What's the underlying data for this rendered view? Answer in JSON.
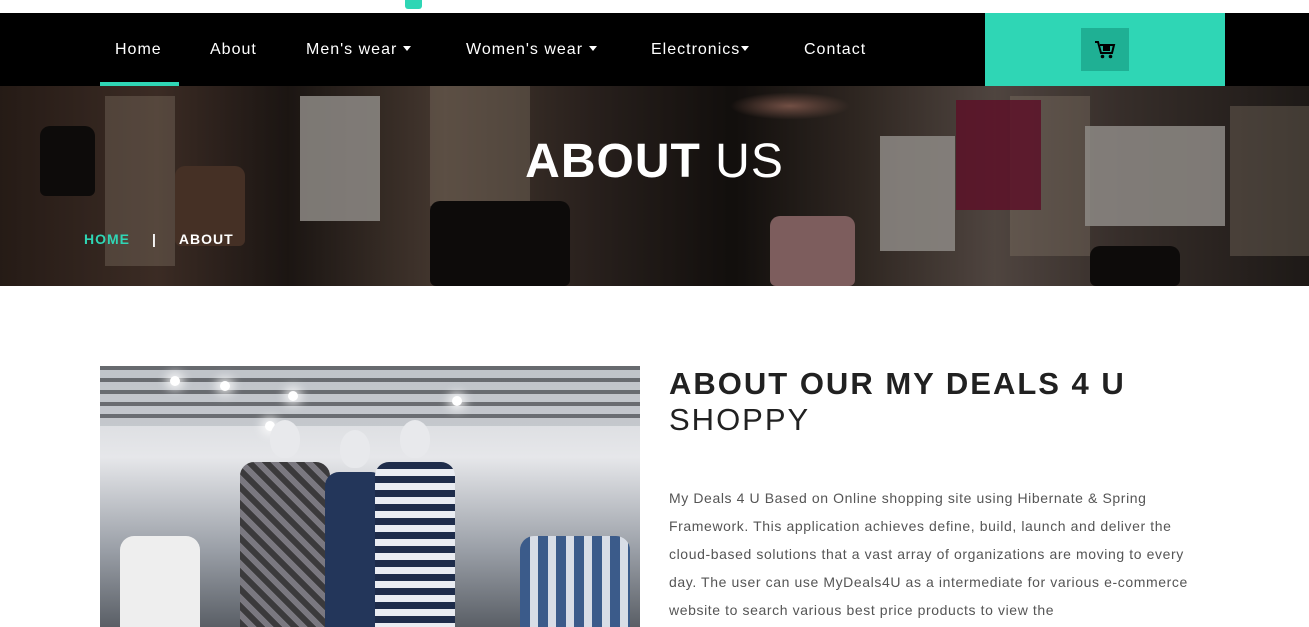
{
  "nav": {
    "items": [
      {
        "label": "Home",
        "active": true,
        "dropdown": false
      },
      {
        "label": "About",
        "active": false,
        "dropdown": false
      },
      {
        "label": "Men's wear",
        "active": false,
        "dropdown": true
      },
      {
        "label": "Women's wear",
        "active": false,
        "dropdown": true
      },
      {
        "label": "Electronics",
        "active": false,
        "dropdown": true
      },
      {
        "label": "Contact",
        "active": false,
        "dropdown": false
      }
    ],
    "cart_icon": "cart-icon"
  },
  "hero": {
    "title_bold": "ABOUT",
    "title_light": "US",
    "breadcrumb_home": "HOME",
    "breadcrumb_sep": "|",
    "breadcrumb_current": "ABOUT"
  },
  "about": {
    "title_bold": "ABOUT OUR MY DEALS 4 U",
    "title_light": "SHOPPY",
    "body": "My Deals 4 U Based on Online shopping site using Hibernate & Spring Framework. This application achieves define, build, launch and deliver the cloud-based solutions that a vast array of organizations are moving to every day. The user can use MyDeals4U as a intermediate for various e-commerce website to search various best price products to view the"
  },
  "colors": {
    "accent": "#2fd6b5",
    "nav_bg": "#000000",
    "heading": "#212121",
    "text": "#555555"
  }
}
